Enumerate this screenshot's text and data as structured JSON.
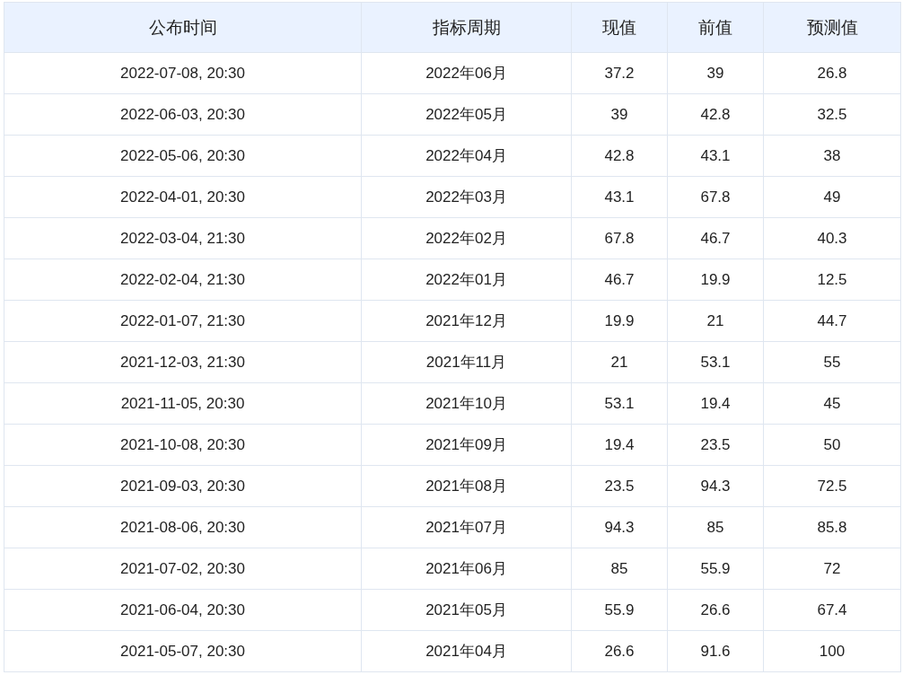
{
  "table": {
    "columns": [
      "公布时间",
      "指标周期",
      "现值",
      "前值",
      "预测值"
    ],
    "rows": [
      [
        "2022-07-08, 20:30",
        "2022年06月",
        "37.2",
        "39",
        "26.8"
      ],
      [
        "2022-06-03, 20:30",
        "2022年05月",
        "39",
        "42.8",
        "32.5"
      ],
      [
        "2022-05-06, 20:30",
        "2022年04月",
        "42.8",
        "43.1",
        "38"
      ],
      [
        "2022-04-01, 20:30",
        "2022年03月",
        "43.1",
        "67.8",
        "49"
      ],
      [
        "2022-03-04, 21:30",
        "2022年02月",
        "67.8",
        "46.7",
        "40.3"
      ],
      [
        "2022-02-04, 21:30",
        "2022年01月",
        "46.7",
        "19.9",
        "12.5"
      ],
      [
        "2022-01-07, 21:30",
        "2021年12月",
        "19.9",
        "21",
        "44.7"
      ],
      [
        "2021-12-03, 21:30",
        "2021年11月",
        "21",
        "53.1",
        "55"
      ],
      [
        "2021-11-05, 20:30",
        "2021年10月",
        "53.1",
        "19.4",
        "45"
      ],
      [
        "2021-10-08, 20:30",
        "2021年09月",
        "19.4",
        "23.5",
        "50"
      ],
      [
        "2021-09-03, 20:30",
        "2021年08月",
        "23.5",
        "94.3",
        "72.5"
      ],
      [
        "2021-08-06, 20:30",
        "2021年07月",
        "94.3",
        "85",
        "85.8"
      ],
      [
        "2021-07-02, 20:30",
        "2021年06月",
        "85",
        "55.9",
        "72"
      ],
      [
        "2021-06-04, 20:30",
        "2021年05月",
        "55.9",
        "26.6",
        "67.4"
      ],
      [
        "2021-05-07, 20:30",
        "2021年04月",
        "26.6",
        "91.6",
        "100"
      ]
    ]
  }
}
